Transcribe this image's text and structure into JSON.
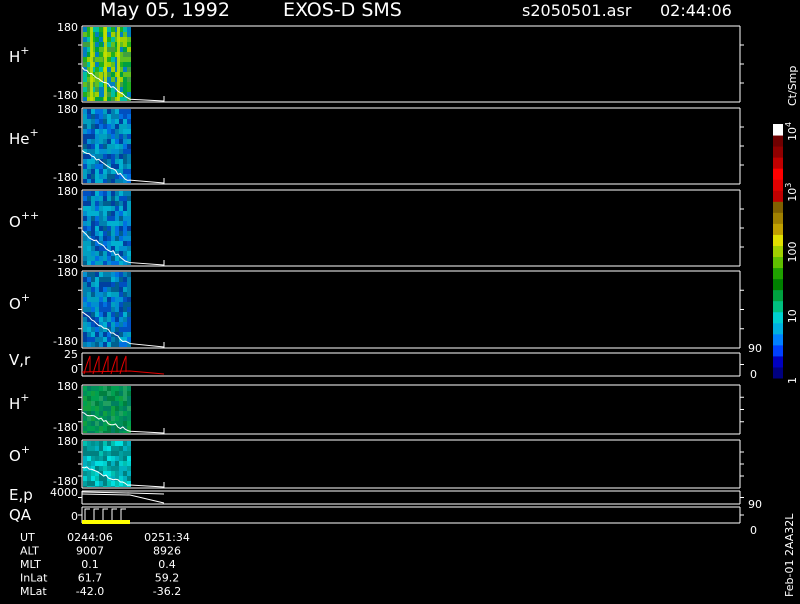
{
  "header": {
    "date": "May 05, 1992",
    "instrument": "EXOS-D SMS",
    "file": "s2050501.asr",
    "time": "02:44:06"
  },
  "chart_data": {
    "type": "heatmap",
    "panels": [
      {
        "id": "h_plus",
        "label": "H",
        "sup": "+",
        "ytop": "180",
        "ybot": "-180",
        "style": "spec",
        "palette": "green"
      },
      {
        "id": "he_plus",
        "label": "He",
        "sup": "+",
        "ytop": "180",
        "ybot": "-180",
        "style": "spec",
        "palette": "blue"
      },
      {
        "id": "o_pp",
        "label": "O",
        "sup": "++",
        "ytop": "180",
        "ybot": "-180",
        "style": "spec",
        "palette": "blue"
      },
      {
        "id": "o_plus",
        "label": "O",
        "sup": "+",
        "ytop": "180",
        "ybot": "-180",
        "style": "spec",
        "palette": "blue",
        "rlabel": [
          "90",
          "0"
        ]
      },
      {
        "id": "vr",
        "label": "V,r",
        "sup": "",
        "ytop": "25",
        "ybot": "0",
        "style": "line"
      },
      {
        "id": "h_plus2",
        "label": "H",
        "sup": "+",
        "ytop": "180",
        "ybot": "-180",
        "style": "spec",
        "palette": "green2"
      },
      {
        "id": "o_plus2",
        "label": "O",
        "sup": "+",
        "ytop": "180",
        "ybot": "-180",
        "style": "spec",
        "palette": "cyan"
      },
      {
        "id": "ep",
        "label": "E,p",
        "sup": "",
        "ytop": "4000",
        "ybot": "",
        "style": "ep",
        "rlabel": [
          "90",
          "0"
        ]
      },
      {
        "id": "qa",
        "label": "QA",
        "sup": "",
        "ytop": "",
        "ybot": "0",
        "style": "qa"
      }
    ],
    "colorbar": {
      "unit": "Ct/Smp",
      "ticks": [
        {
          "label": "1",
          "value": 1
        },
        {
          "label": "10",
          "value": 10
        },
        {
          "label": "100",
          "value": 100
        },
        {
          "label": "10",
          "sup": "3",
          "value": 1000
        },
        {
          "label": "10",
          "sup": "4",
          "value": 10000
        }
      ],
      "colors": [
        "#000080",
        "#0000c0",
        "#0040ff",
        "#0080ff",
        "#00b0e0",
        "#00d0d0",
        "#00c080",
        "#00a040",
        "#008000",
        "#20a000",
        "#60c000",
        "#a0d000",
        "#e0e000",
        "#c0a000",
        "#a08000",
        "#806000",
        "#c00000",
        "#e00000",
        "#ff0000",
        "#c00000",
        "#900000",
        "#700000",
        "#ffffff"
      ]
    },
    "footer": {
      "rows": [
        {
          "name": "UT",
          "start": "0244:06",
          "end": "0251:34"
        },
        {
          "name": "ALT",
          "start": "9007",
          "end": "8926"
        },
        {
          "name": "MLT",
          "start": "0.1",
          "end": "0.4"
        },
        {
          "name": "InLat",
          "start": "61.7",
          "end": "59.2"
        },
        {
          "name": "MLat",
          "start": "-42.0",
          "end": "-36.2"
        }
      ]
    },
    "side_label": "Feb-01  2AA32L"
  }
}
